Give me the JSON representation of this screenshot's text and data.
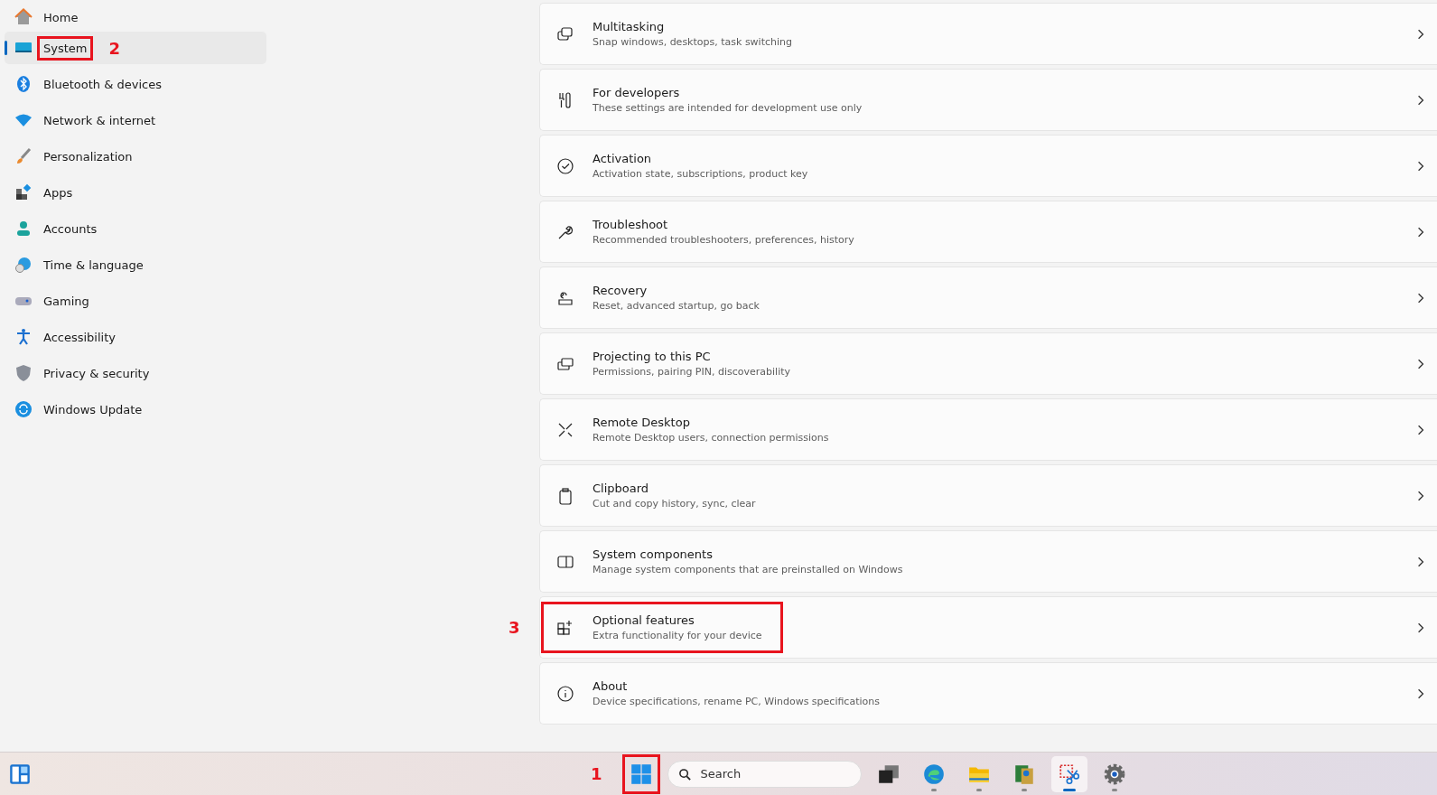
{
  "sidebar": {
    "items": [
      {
        "label": "Home",
        "selected": false
      },
      {
        "label": "System",
        "selected": true,
        "marker": "2"
      },
      {
        "label": "Bluetooth & devices",
        "selected": false
      },
      {
        "label": "Network & internet",
        "selected": false
      },
      {
        "label": "Personalization",
        "selected": false
      },
      {
        "label": "Apps",
        "selected": false
      },
      {
        "label": "Accounts",
        "selected": false
      },
      {
        "label": "Time & language",
        "selected": false
      },
      {
        "label": "Gaming",
        "selected": false
      },
      {
        "label": "Accessibility",
        "selected": false
      },
      {
        "label": "Privacy & security",
        "selected": false
      },
      {
        "label": "Windows Update",
        "selected": false
      }
    ]
  },
  "settings": [
    {
      "title": "Multitasking",
      "description": "Snap windows, desktops, task switching"
    },
    {
      "title": "For developers",
      "description": "These settings are intended for development use only"
    },
    {
      "title": "Activation",
      "description": "Activation state, subscriptions, product key"
    },
    {
      "title": "Troubleshoot",
      "description": "Recommended troubleshooters, preferences, history"
    },
    {
      "title": "Recovery",
      "description": "Reset, advanced startup, go back"
    },
    {
      "title": "Projecting to this PC",
      "description": "Permissions, pairing PIN, discoverability"
    },
    {
      "title": "Remote Desktop",
      "description": "Remote Desktop users, connection permissions"
    },
    {
      "title": "Clipboard",
      "description": "Cut and copy history, sync, clear"
    },
    {
      "title": "System components",
      "description": "Manage system components that are preinstalled on Windows"
    },
    {
      "title": "Optional features",
      "description": "Extra functionality for your device",
      "marker": "3"
    },
    {
      "title": "About",
      "description": "Device specifications, rename PC, Windows specifications"
    }
  ],
  "taskbar": {
    "start_marker": "1",
    "search": {
      "placeholder": "Search"
    },
    "apps": [
      {
        "kind": "taskview",
        "running": false,
        "selected": false
      },
      {
        "kind": "browser",
        "running": true,
        "selected": false
      },
      {
        "kind": "folder",
        "running": true,
        "selected": false
      },
      {
        "kind": "app",
        "running": true,
        "selected": false
      },
      {
        "kind": "snip",
        "running": true,
        "selected": true
      },
      {
        "kind": "settings",
        "running": true,
        "selected": false
      }
    ]
  }
}
